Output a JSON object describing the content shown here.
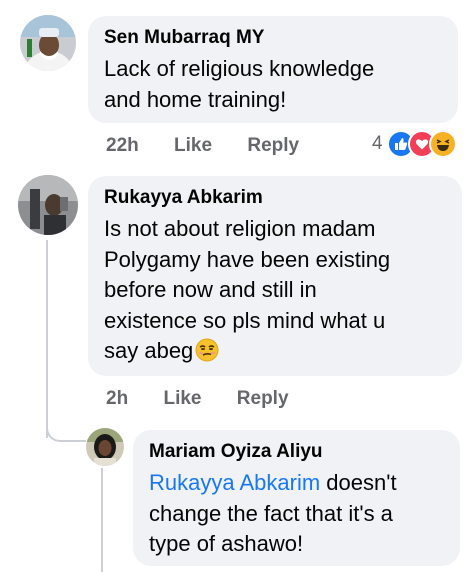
{
  "comments": [
    {
      "author": "Sen Mubarraq MY",
      "text_lines": [
        "Lack of religious knowledge",
        "and home training!"
      ],
      "time": "22h",
      "like_label": "Like",
      "reply_label": "Reply",
      "reaction_count": "4",
      "reactions": [
        "like-reaction-icon",
        "love-reaction-icon",
        "haha-reaction-icon"
      ]
    },
    {
      "author": "Rukayya Abkarim",
      "text_lines": [
        "Is not about religion madam",
        "Polygamy have been existing",
        "before now and still in",
        "existence so pls mind what u",
        "say abeg"
      ],
      "emoji": "unamused-face-emoji",
      "time": "2h",
      "like_label": "Like",
      "reply_label": "Reply"
    },
    {
      "author": "Mariam Oyiza Aliyu",
      "mention": "Rukayya Abkarim",
      "text_first_rest": " doesn't",
      "text_lines": [
        "change the fact that it's a",
        "type of ashawo!"
      ]
    }
  ],
  "colors": {
    "bubble": "#f0f2f5",
    "meta_text": "#65676b",
    "mention": "#1877f2",
    "thread_line": "#ccd0d5"
  }
}
